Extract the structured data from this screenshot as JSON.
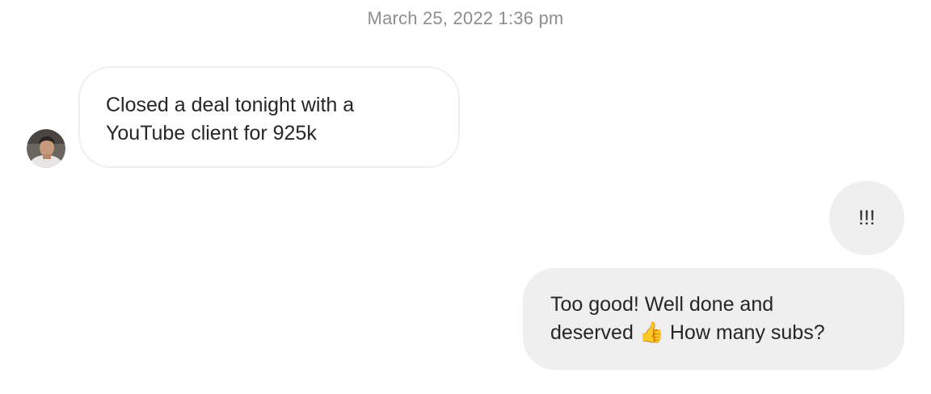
{
  "thread": {
    "timestamp": "March 25, 2022 1:36 pm"
  },
  "messages": [
    {
      "sender": "other",
      "lines": [
        "Closed a deal tonight with a",
        "YouTube client for 925k"
      ]
    },
    {
      "sender": "me",
      "text": "!!!"
    },
    {
      "sender": "me",
      "lines": [
        "Too good! Well done and",
        "deserved 👍 How many subs?"
      ]
    }
  ],
  "icons": {
    "avatar": "profile-photo",
    "emoji": "thumbs-up"
  },
  "colors": {
    "incoming_bubble_border": "#efefef",
    "outgoing_bubble_bg": "#efefef",
    "text": "#262626",
    "timestamp": "#8e8e8e"
  }
}
